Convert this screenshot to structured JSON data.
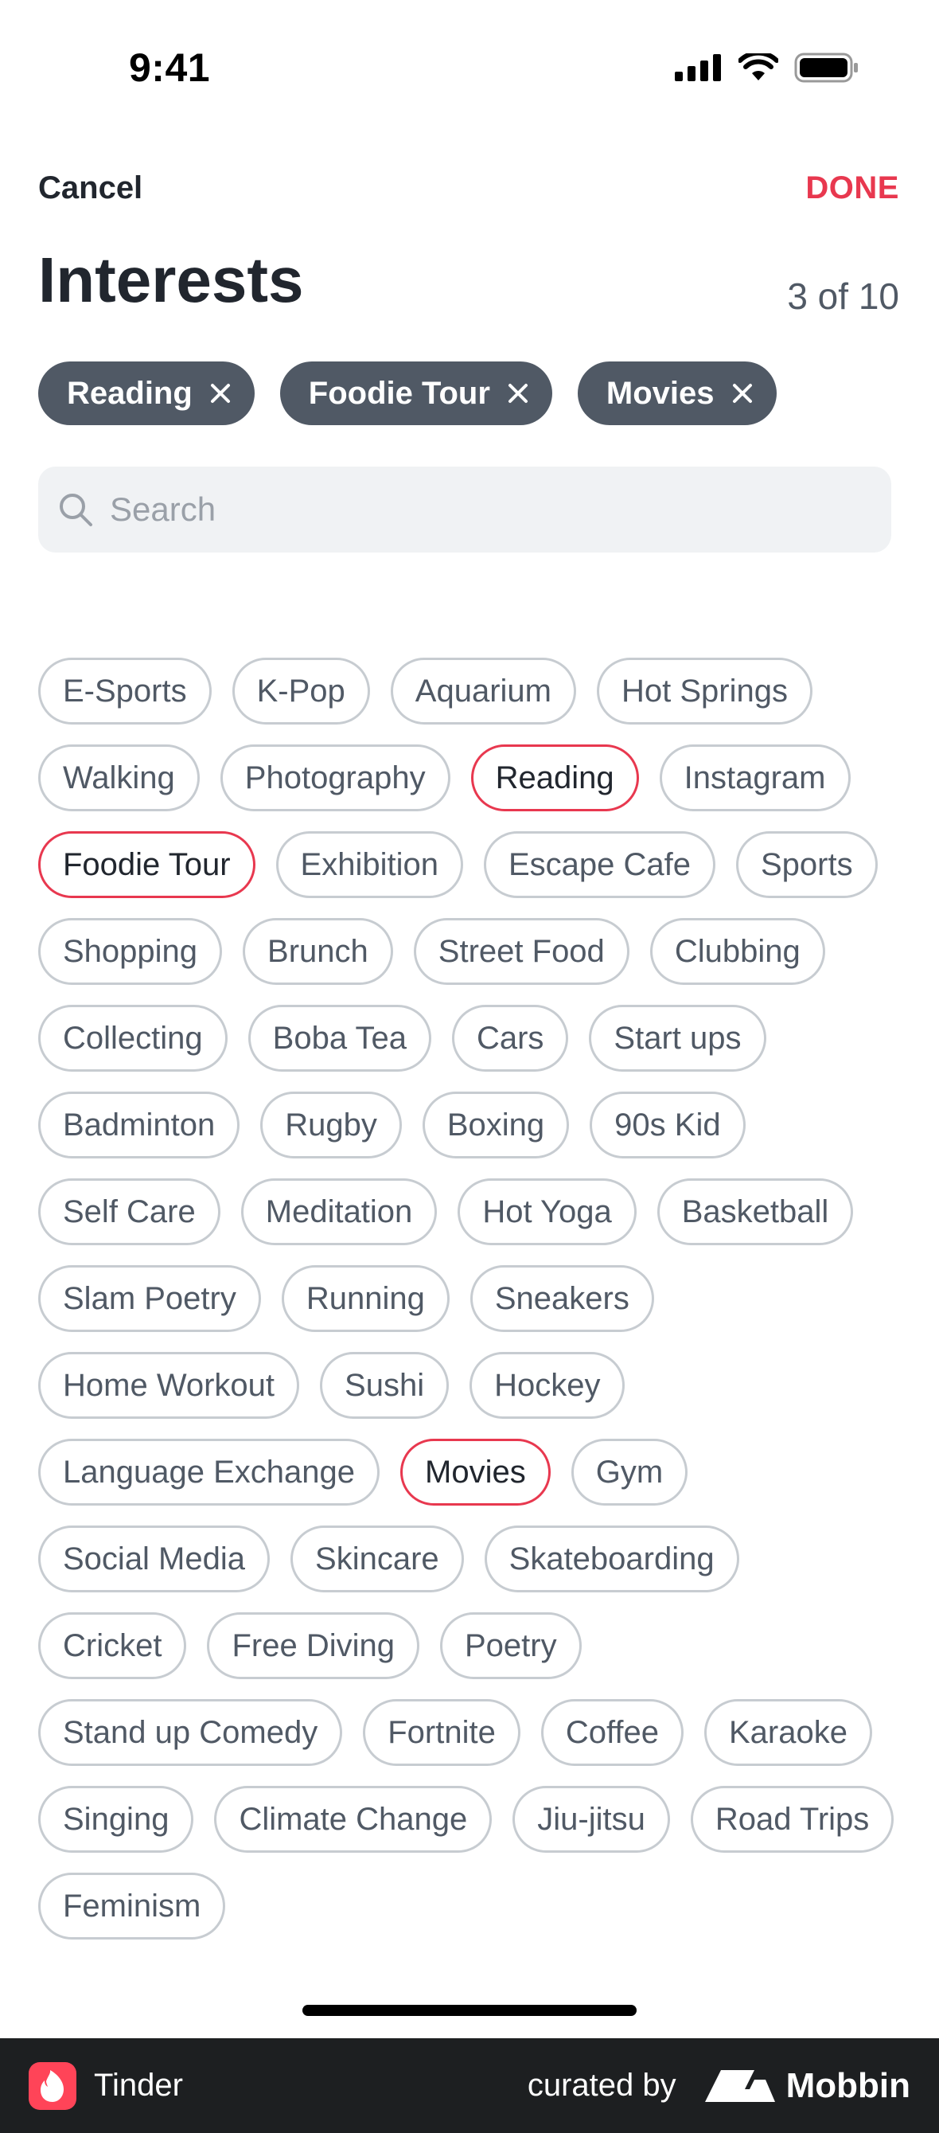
{
  "status_bar": {
    "time": "9:41"
  },
  "header": {
    "cancel_label": "Cancel",
    "done_label": "DONE",
    "title": "Interests",
    "counter": "3 of 10",
    "accent_color": "#e8384f"
  },
  "selected": [
    "Reading",
    "Foodie Tour",
    "Movies"
  ],
  "search": {
    "placeholder": "Search",
    "value": ""
  },
  "interests": [
    "E-Sports",
    "K-Pop",
    "Aquarium",
    "Hot Springs",
    "Walking",
    "Photography",
    "Reading",
    "Instagram",
    "Foodie Tour",
    "Exhibition",
    "Escape Cafe",
    "Sports",
    "Shopping",
    "Brunch",
    "Street Food",
    "Clubbing",
    "Collecting",
    "Boba Tea",
    "Cars",
    "Start ups",
    "Badminton",
    "Rugby",
    "Boxing",
    "90s Kid",
    "Self Care",
    "Meditation",
    "Hot Yoga",
    "Basketball",
    "Slam Poetry",
    "Running",
    "Sneakers",
    "Home Workout",
    "Sushi",
    "Hockey",
    "Language Exchange",
    "Movies",
    "Gym",
    "Social Media",
    "Skincare",
    "Skateboarding",
    "Cricket",
    "Free Diving",
    "Poetry",
    "Stand up Comedy",
    "Fortnite",
    "Coffee",
    "Karaoke",
    "Singing",
    "Climate Change",
    "Jiu-jitsu",
    "Road Trips",
    "Feminism"
  ],
  "footer": {
    "app_name": "Tinder",
    "curated_by": "curated by",
    "brand": "Mobbin"
  }
}
